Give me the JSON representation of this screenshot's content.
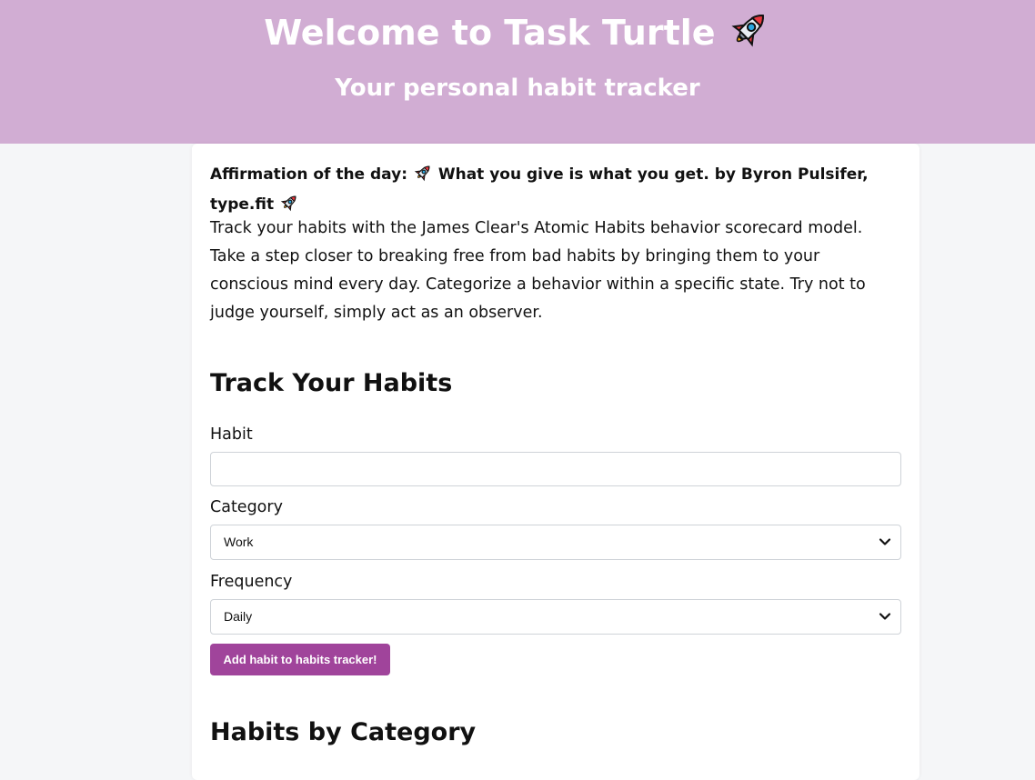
{
  "header": {
    "title": "Welcome to Task Turtle",
    "title_emoji": "rocket-icon",
    "subtitle": "Your personal habit tracker"
  },
  "affirmation": {
    "prefix": "Affirmation of the day:",
    "quote": "What you give is what you get.",
    "author": "by Byron Pulsifer, type.fit"
  },
  "intro": "Track your habits with the James Clear's Atomic Habits behavior scorecard model. Take a step closer to breaking free from bad habits by bringing them to your conscious mind every day. Categorize a behavior within a specific state. Try not to judge yourself, simply act as an observer.",
  "form": {
    "title": "Track Your Habits",
    "habit_label": "Habit",
    "habit_value": "",
    "habit_placeholder": "",
    "category_label": "Category",
    "category_value": "Work",
    "frequency_label": "Frequency",
    "frequency_value": "Daily",
    "submit_label": "Add habit to habits tracker!"
  },
  "habits_by_category": {
    "title": "Habits by Category"
  },
  "colors": {
    "header_bg": "#d1add3",
    "button_bg": "#a0449b",
    "page_bg": "#f5f6f8"
  }
}
